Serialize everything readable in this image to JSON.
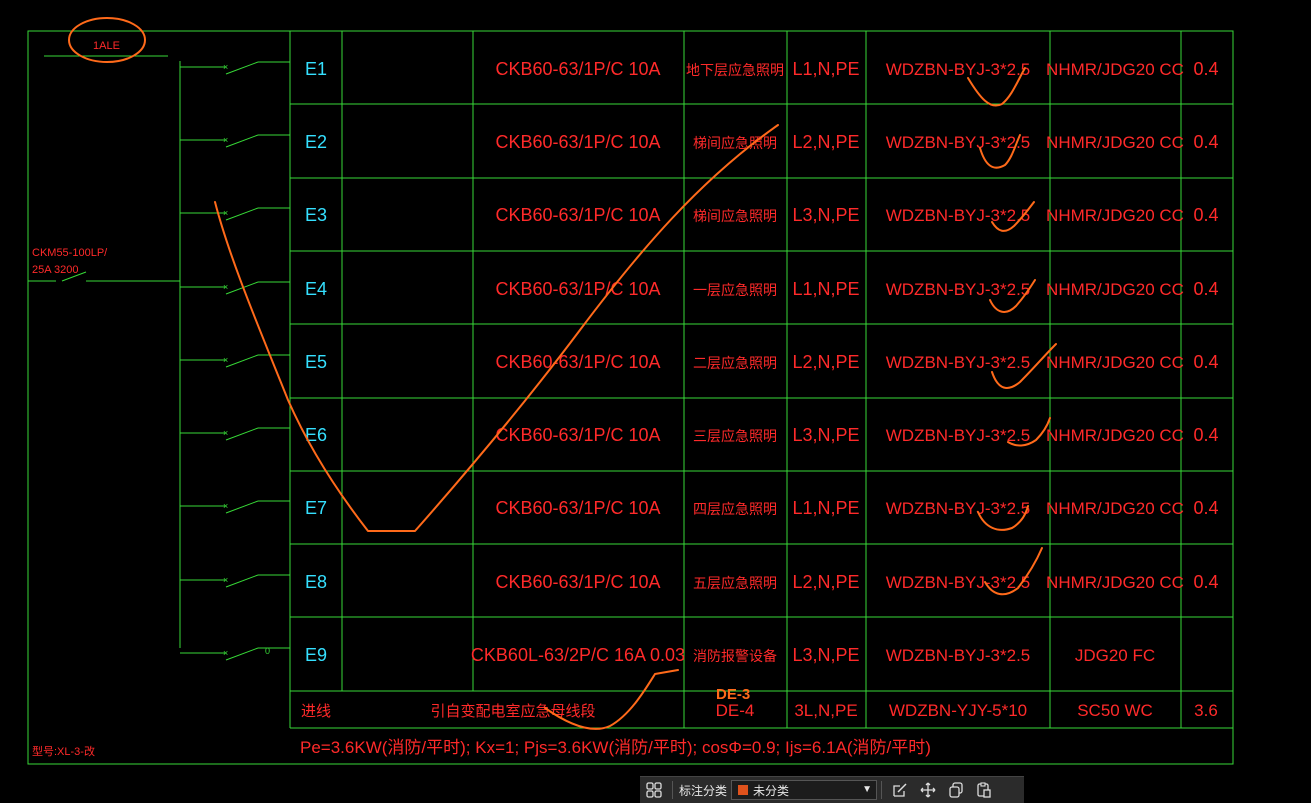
{
  "colors": {
    "grid": "#37d937",
    "text_red": "#ff2a2a",
    "text_cyan": "#35e0ff",
    "ink": "#ff6a1a"
  },
  "panel": {
    "name_label": "1ALE",
    "main_breaker_line1": "CKM55-100LP/",
    "main_breaker_line2": "25A 3200",
    "model_label": "型号:XL-3-改"
  },
  "circuits": [
    {
      "id": "E1",
      "breaker": "CKB60-63/1P/C 10A",
      "load": "地下层应急照明",
      "phase": "L1,N,PE",
      "cable": "WDZBN-BYJ-3*2.5",
      "conduit": "NHMR/JDG20 CC",
      "power": "0.4"
    },
    {
      "id": "E2",
      "breaker": "CKB60-63/1P/C 10A",
      "load": "梯间应急照明",
      "phase": "L2,N,PE",
      "cable": "WDZBN-BYJ-3*2.5",
      "conduit": "NHMR/JDG20 CC",
      "power": "0.4"
    },
    {
      "id": "E3",
      "breaker": "CKB60-63/1P/C 10A",
      "load": "梯间应急照明",
      "phase": "L3,N,PE",
      "cable": "WDZBN-BYJ-3*2.5",
      "conduit": "NHMR/JDG20 CC",
      "power": "0.4"
    },
    {
      "id": "E4",
      "breaker": "CKB60-63/1P/C 10A",
      "load": "一层应急照明",
      "phase": "L1,N,PE",
      "cable": "WDZBN-BYJ-3*2.5",
      "conduit": "NHMR/JDG20 CC",
      "power": "0.4"
    },
    {
      "id": "E5",
      "breaker": "CKB60-63/1P/C 10A",
      "load": "二层应急照明",
      "phase": "L2,N,PE",
      "cable": "WDZBN-BYJ-3*2.5",
      "conduit": "NHMR/JDG20 CC",
      "power": "0.4"
    },
    {
      "id": "E6",
      "breaker": "CKB60-63/1P/C 10A",
      "load": "三层应急照明",
      "phase": "L3,N,PE",
      "cable": "WDZBN-BYJ-3*2.5",
      "conduit": "NHMR/JDG20 CC",
      "power": "0.4"
    },
    {
      "id": "E7",
      "breaker": "CKB60-63/1P/C 10A",
      "load": "四层应急照明",
      "phase": "L1,N,PE",
      "cable": "WDZBN-BYJ-3*2.5",
      "conduit": "NHMR/JDG20 CC",
      "power": "0.4"
    },
    {
      "id": "E8",
      "breaker": "CKB60-63/1P/C 10A",
      "load": "五层应急照明",
      "phase": "L2,N,PE",
      "cable": "WDZBN-BYJ-3*2.5",
      "conduit": "NHMR/JDG20 CC",
      "power": "0.4"
    },
    {
      "id": "E9",
      "breaker": "CKB60L-63/2P/C 16A 0.03",
      "load": "消防报警设备",
      "phase": "L3,N,PE",
      "cable": "WDZBN-BYJ-3*2.5",
      "conduit": "JDG20 FC",
      "power": ""
    }
  ],
  "incoming": {
    "label": "进线",
    "source": "引自变配电室应急母线段",
    "code": "DE-4",
    "phase": "3L,N,PE",
    "cable": "WDZBN-YJY-5*10",
    "conduit": "SC50 WC",
    "power": "3.6"
  },
  "annotation": {
    "correction": "DE-3"
  },
  "summary": "Pe=3.6KW(消防/平时); Kx=1; Pjs=3.6KW(消防/平时); cosΦ=0.9; Ijs=6.1A(消防/平时)",
  "toolbar": {
    "grid_icon": "grid-icon",
    "category_label": "标注分类",
    "category_value": "未分类",
    "category_color": "#e0521c",
    "icons": [
      "edit-icon",
      "move-icon",
      "copy-icon",
      "paste-icon"
    ]
  }
}
